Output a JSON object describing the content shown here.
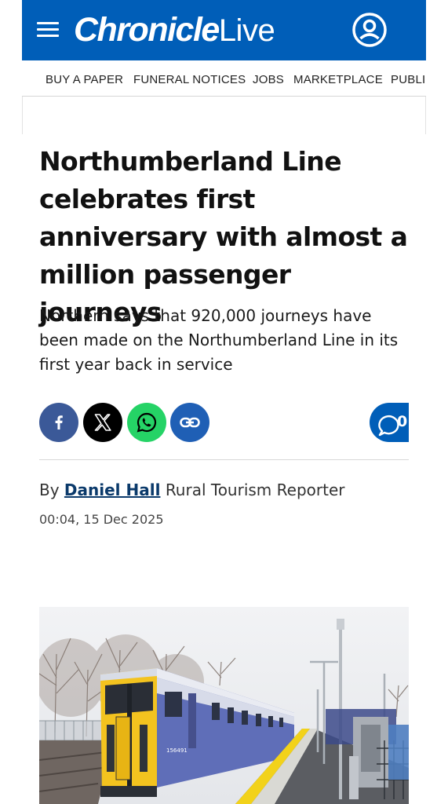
{
  "brand": {
    "name_bold": "Chronicle",
    "name_light": "Live",
    "color": "#005eb8"
  },
  "header": {
    "menu_icon": "hamburger-menu-icon",
    "account_icon": "account-icon"
  },
  "nav": {
    "items": [
      "BUY A PAPER",
      "FUNERAL NOTICES",
      "JOBS",
      "MARKETPLACE",
      "PUBLI"
    ]
  },
  "article": {
    "headline": "Northumberland Line celebrates first anniversary with almost a million passenger journeys",
    "standfirst": "Northern says that 920,000 journeys have been made on the Northumberland Line in its first year back in service",
    "share": {
      "icons": [
        "facebook-icon",
        "x-icon",
        "whatsapp-icon",
        "copy-link-icon"
      ],
      "comment_count": "0"
    },
    "byline": {
      "prefix": "By",
      "author": "Daniel Hall",
      "role": "Rural Tourism Reporter",
      "timestamp": "00:04, 15 Dec 2025"
    },
    "image": {
      "train_number": "156491"
    }
  }
}
